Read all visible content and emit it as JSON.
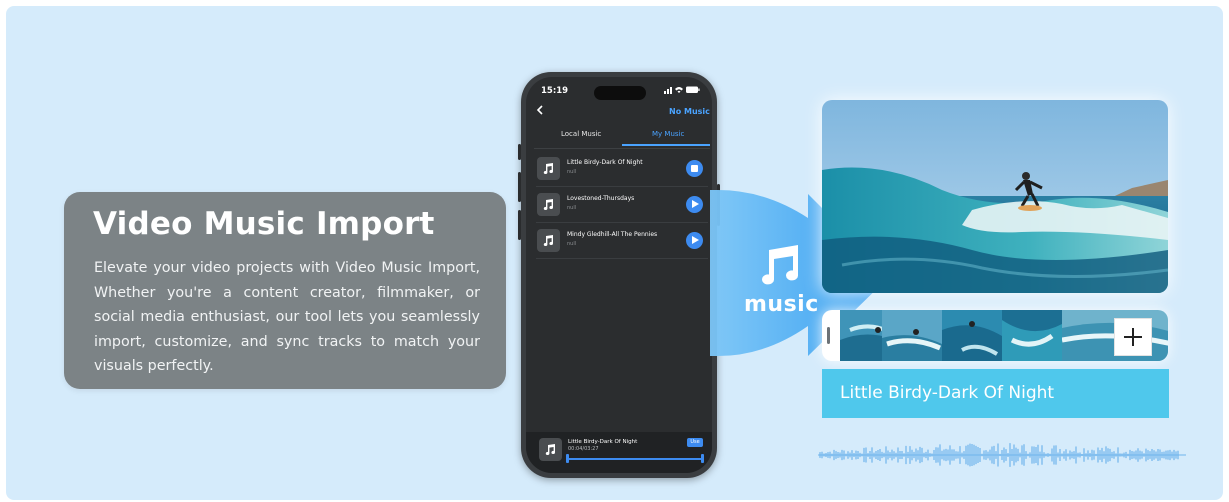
{
  "info_card": {
    "title": "Video Music Import",
    "description": "Elevate your video projects with Video Music Import, Whether you're a content creator, filmmaker, or social media enthusiast, our tool lets you seamlessly import, customize, and sync tracks to match your visuals perfectly."
  },
  "phone": {
    "status_time": "15:19",
    "status_icons": "∷ ▿ ▮",
    "back_icon": "chevron-left-icon",
    "header_action": "No Music",
    "tabs": [
      {
        "label": "Local Music",
        "active": false
      },
      {
        "label": "My Music",
        "active": true
      }
    ],
    "tracks": [
      {
        "title": "Little Birdy-Dark Of Night",
        "subtitle": "null",
        "state": "stop"
      },
      {
        "title": "Lovestoned-Thursdays",
        "subtitle": "null",
        "state": "play"
      },
      {
        "title": "Mindy Gledhill-All The Pennies",
        "subtitle": "null",
        "state": "play"
      }
    ],
    "player": {
      "title": "Little Birdy-Dark Of Night",
      "time": "00:04/03:27",
      "use_label": "Use"
    }
  },
  "funnel": {
    "label": "music",
    "icon": "music-note-icon"
  },
  "editor": {
    "timeline_add_icon": "plus-icon",
    "track_name": "Little Birdy-Dark Of Night"
  },
  "colors": {
    "background": "#d5ebfb",
    "card": "#7c8386",
    "accent_blue": "#3d8bf0",
    "track_bar": "#4fc8ec",
    "funnel": "#3da7f3"
  }
}
